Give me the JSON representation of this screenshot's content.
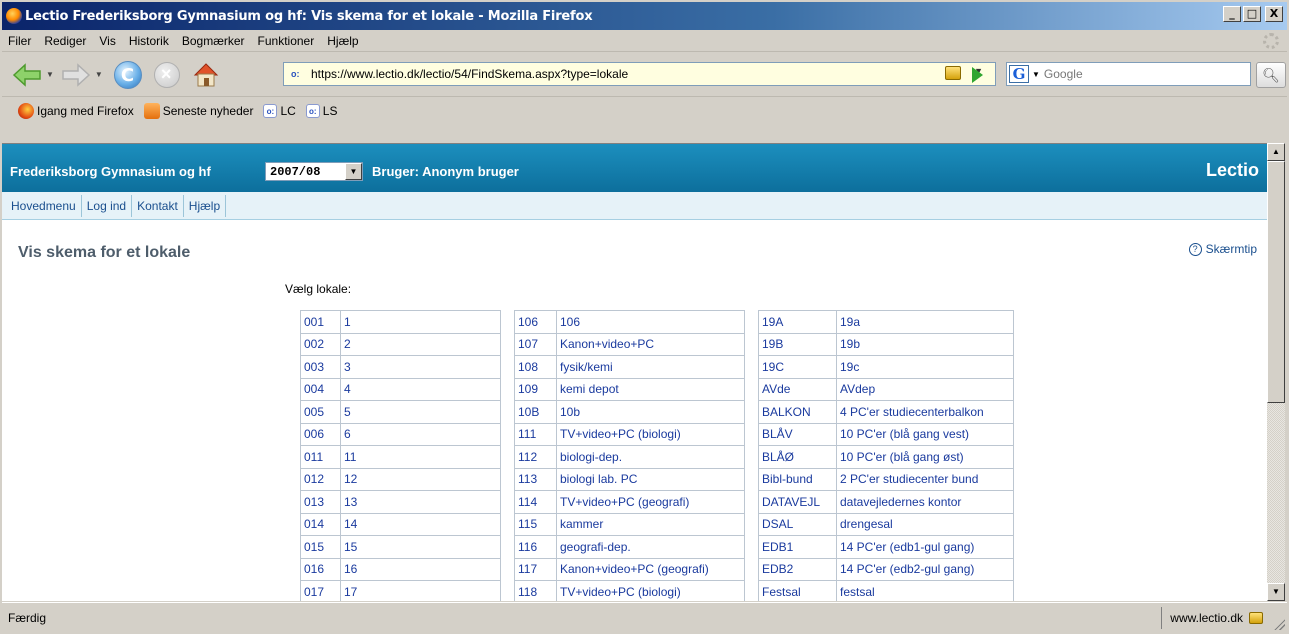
{
  "window": {
    "title": "Lectio Frederiksborg Gymnasium og hf: Vis skema for et lokale - Mozilla Firefox",
    "minimize": "_",
    "maximize": "□",
    "close": "X"
  },
  "menu": [
    "Filer",
    "Rediger",
    "Vis",
    "Historik",
    "Bogmærker",
    "Funktioner",
    "Hjælp"
  ],
  "nav": {
    "url": "https://www.lectio.dk/lectio/54/FindSkema.aspx?type=lokale",
    "search_placeholder": "Google"
  },
  "bookmarks": [
    {
      "label": "Igang med Firefox",
      "icon": "firefox-icon"
    },
    {
      "label": "Seneste nyheder",
      "icon": "rss-icon"
    },
    {
      "label": "LC",
      "icon": "lectio-favicon"
    },
    {
      "label": "LS",
      "icon": "lectio-favicon"
    }
  ],
  "lectio": {
    "school": "Frederiksborg Gymnasium og hf",
    "year": "2007/08",
    "user": "Bruger: Anonym bruger",
    "brand": "Lectio",
    "tabs": [
      "Hovedmenu",
      "Log ind",
      "Kontakt",
      "Hjælp"
    ]
  },
  "page": {
    "title": "Vis skema for et lokale",
    "tip": "Skærmtip",
    "pick_label": "Vælg lokale:"
  },
  "rooms": [
    [
      "001",
      "1",
      "106",
      "106",
      "19A",
      "19a"
    ],
    [
      "002",
      "2",
      "107",
      "Kanon+video+PC",
      "19B",
      "19b"
    ],
    [
      "003",
      "3",
      "108",
      "fysik/kemi",
      "19C",
      "19c"
    ],
    [
      "004",
      "4",
      "109",
      "kemi depot",
      "AVde",
      "AVdep"
    ],
    [
      "005",
      "5",
      "10B",
      "10b",
      "BALKON",
      "4 PC'er studiecenterbalkon"
    ],
    [
      "006",
      "6",
      "111",
      "TV+video+PC (biologi)",
      "BLÅV",
      "10 PC'er (blå gang vest)"
    ],
    [
      "011",
      "11",
      "112",
      "biologi-dep.",
      "BLÅØ",
      "10 PC'er (blå gang øst)"
    ],
    [
      "012",
      "12",
      "113",
      "biologi lab. PC",
      "Bibl-bund",
      "2 PC'er studiecenter bund"
    ],
    [
      "013",
      "13",
      "114",
      "TV+video+PC (geografi)",
      "DATAVEJL",
      "datavejledernes kontor"
    ],
    [
      "014",
      "14",
      "115",
      "kammer",
      "DSAL",
      "drengesal"
    ],
    [
      "015",
      "15",
      "116",
      "geografi-dep.",
      "EDB1",
      "14 PC'er (edb1-gul gang)"
    ],
    [
      "016",
      "16",
      "117",
      "Kanon+video+PC (geografi)",
      "EDB2",
      "14 PC'er (edb2-gul gang)"
    ],
    [
      "017",
      "17",
      "118",
      "TV+video+PC (biologi)",
      "Festsal",
      "festsal"
    ]
  ],
  "status": {
    "text": "Færdig",
    "site": "www.lectio.dk"
  }
}
